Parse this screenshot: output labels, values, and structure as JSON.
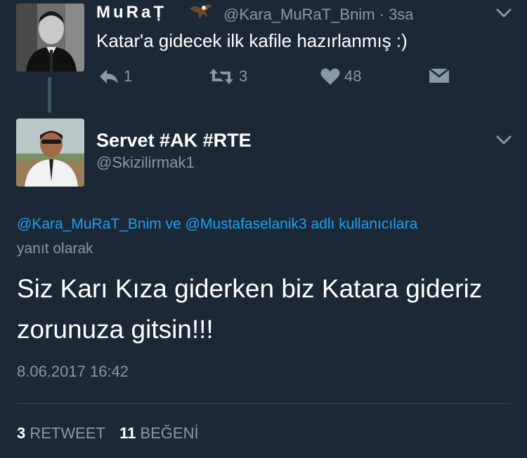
{
  "parent_tweet": {
    "display_name": "MuRaȚ",
    "handle_time": "@Kara_MuRaT_Bnim · 3sa",
    "text": "Katar'a gidecek ilk kafile hazırlanmış :)",
    "replies": "1",
    "retweets": "3",
    "likes": "48",
    "avatar_icon": "man-portrait-avatar",
    "emoji_icon": "eagle-icon"
  },
  "focused_tweet": {
    "display_name": "Servet #AK #RTE",
    "handle": "@Skizilirmak1",
    "reply_mention_1": "@Kara_MuRaT_Bnim",
    "reply_and": " ve ",
    "reply_mention_2": "@Mustafaselanik3",
    "reply_suffix": " adlı kullanıcılara",
    "reply_line2": "yanıt olarak",
    "text": "Siz Karı Kıza giderken biz Katara gideriz zorunuza gitsin!!!",
    "timestamp": "8.06.2017 16:42",
    "retweet_count": "3",
    "retweet_label": "RETWEET",
    "like_count": "11",
    "like_label": "BEĞENİ"
  },
  "colors": {
    "background": "#1b2836",
    "secondary_text": "#8899a6",
    "link": "#1da1f2"
  }
}
